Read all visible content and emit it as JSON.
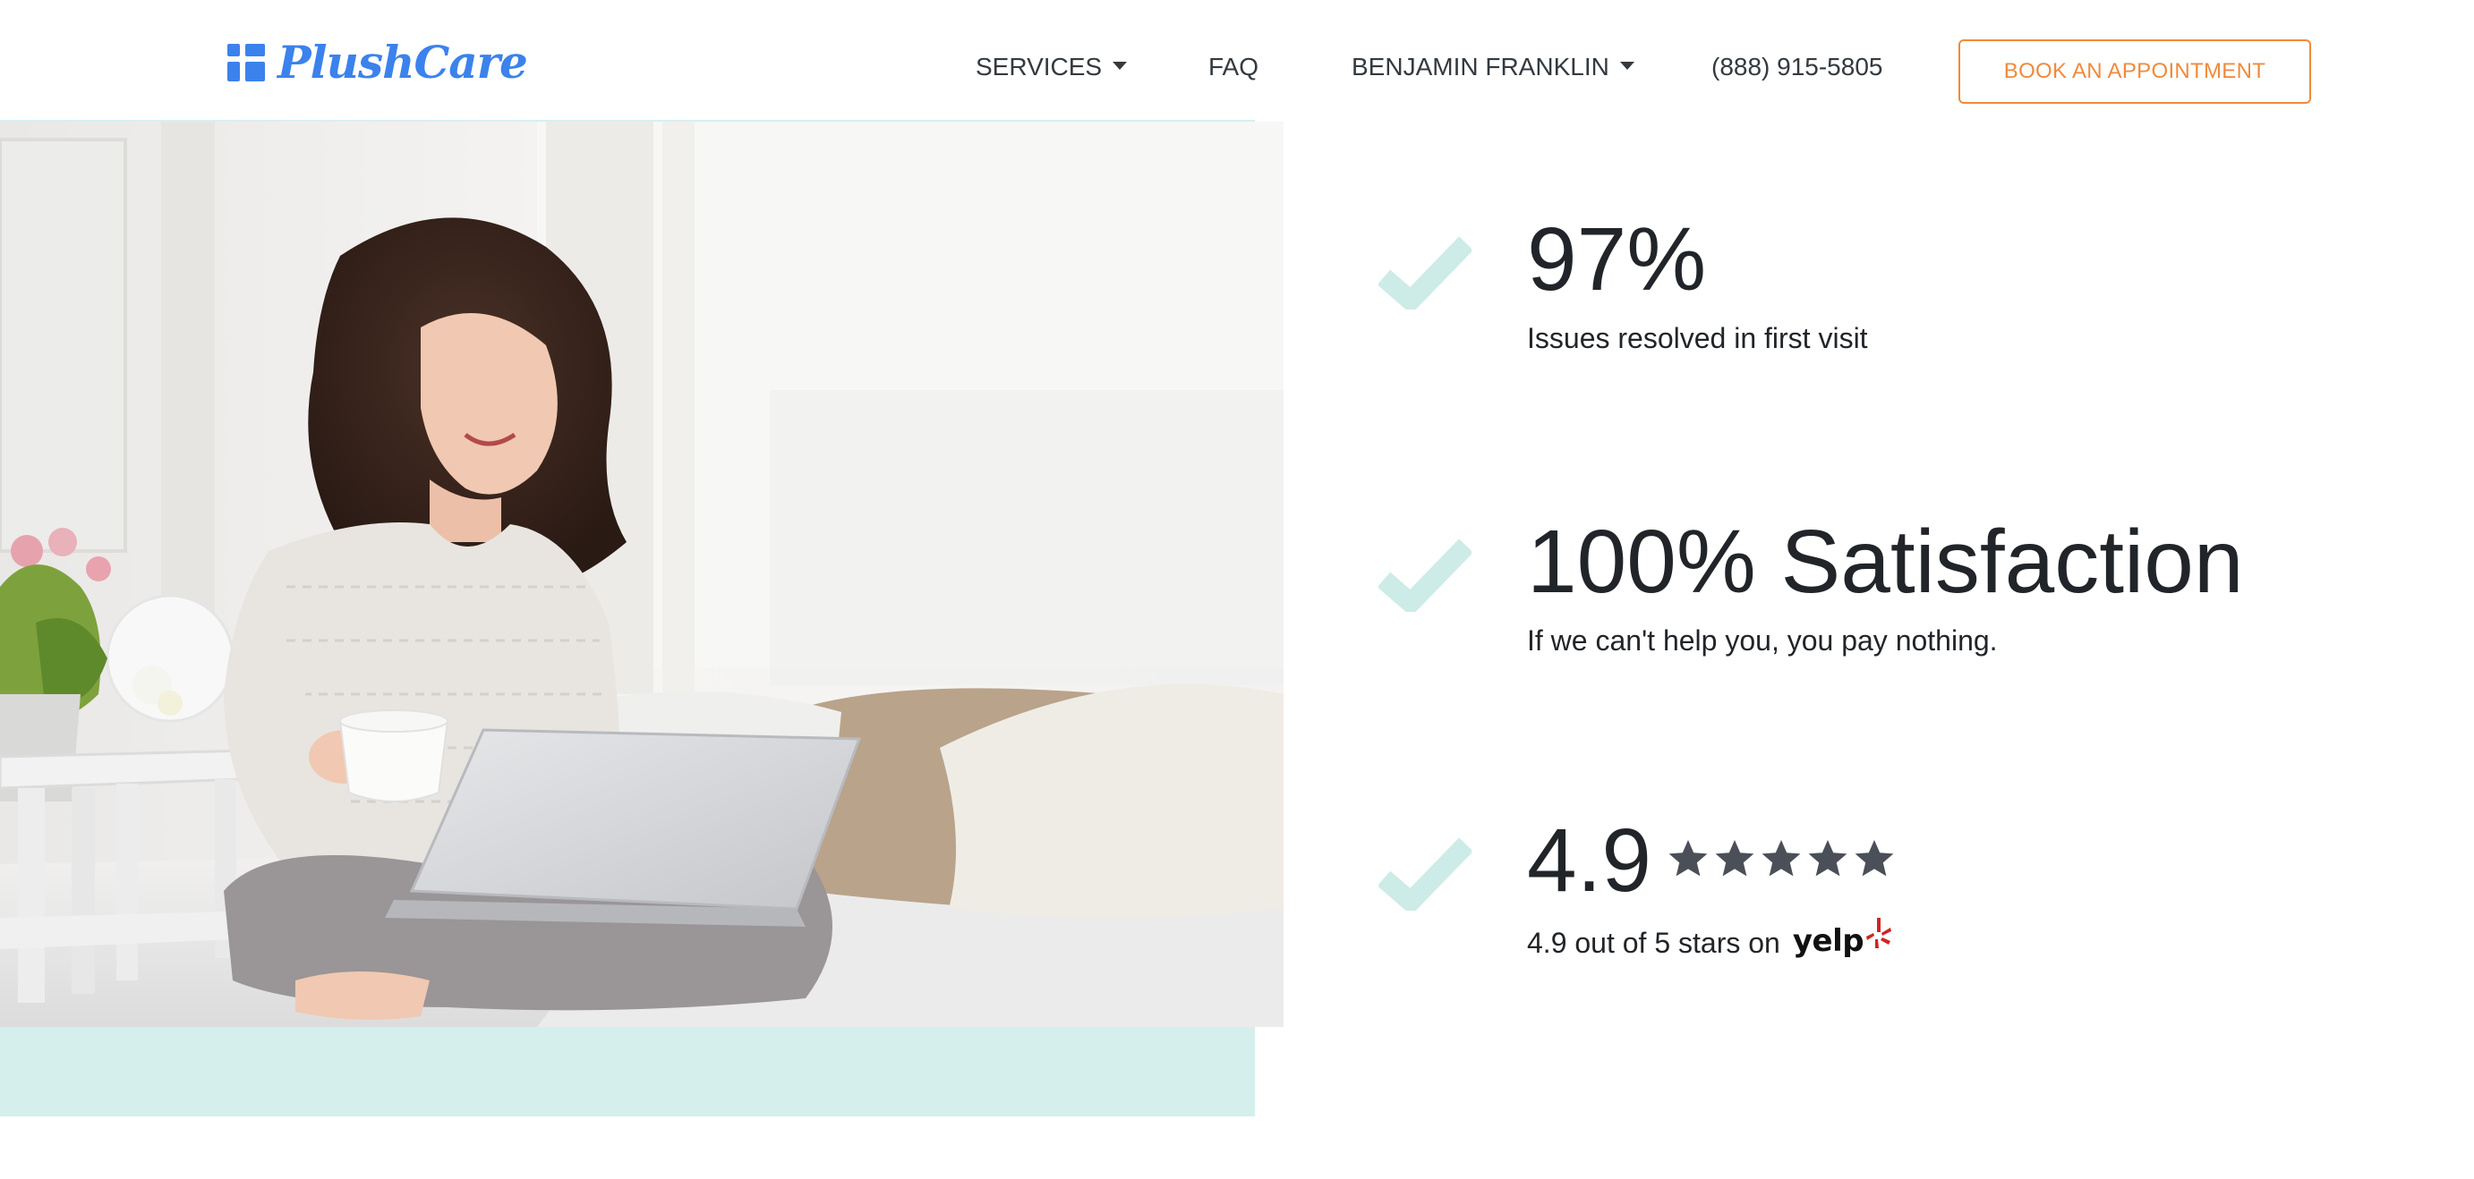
{
  "brand": {
    "logo_text": "PlushCare",
    "logo_color": "#3b82ec"
  },
  "nav": {
    "services_label": "SERVICES",
    "faq_label": "FAQ",
    "user_label": "BENJAMIN FRANKLIN",
    "phone": "(888) 915-5805",
    "book_label": "BOOK AN APPOINTMENT",
    "book_color": "#f08a3c"
  },
  "stats": [
    {
      "value": "97%",
      "description": "Issues resolved in first visit"
    },
    {
      "value": "100% Satisfaction",
      "description": "If we can't help you, you pay nothing."
    },
    {
      "value": "4.9",
      "description": "4.9 out of 5 stars on",
      "rating_stars": 5,
      "source": "yelp"
    }
  ],
  "colors": {
    "check": "#cdebe7",
    "accent_band": "#d4efec",
    "star": "#4a4f58",
    "yelp_red": "#d32323"
  },
  "icons": {
    "check": "check-icon",
    "star": "star-icon",
    "caret": "caret-down-icon",
    "yelp": "yelp-logo"
  }
}
